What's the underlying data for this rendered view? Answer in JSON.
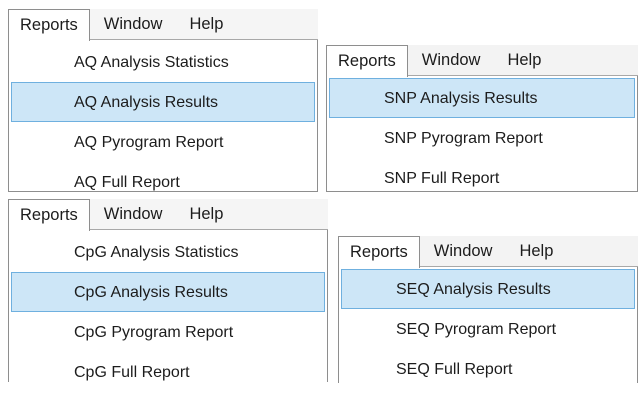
{
  "colors": {
    "highlight_fill": "#cde6f7",
    "highlight_border": "#6fb0df",
    "border": "#8e8e8e"
  },
  "menu_tabs": [
    "Reports",
    "Window",
    "Help"
  ],
  "panels": {
    "aq": {
      "items": [
        "AQ Analysis Statistics",
        "AQ Analysis Results",
        "AQ Pyrogram Report",
        "AQ Full Report"
      ],
      "selected": "AQ Analysis Results"
    },
    "snp": {
      "items": [
        "SNP Analysis Results",
        "SNP Pyrogram Report",
        "SNP Full Report"
      ],
      "selected": "SNP Analysis Results"
    },
    "cpg": {
      "items": [
        "CpG Analysis Statistics",
        "CpG Analysis Results",
        "CpG Pyrogram Report",
        "CpG Full Report"
      ],
      "selected": "CpG Analysis Results"
    },
    "seq": {
      "items": [
        "SEQ Analysis Results",
        "SEQ Pyrogram Report",
        "SEQ Full Report"
      ],
      "selected": "SEQ Analysis Results"
    }
  }
}
